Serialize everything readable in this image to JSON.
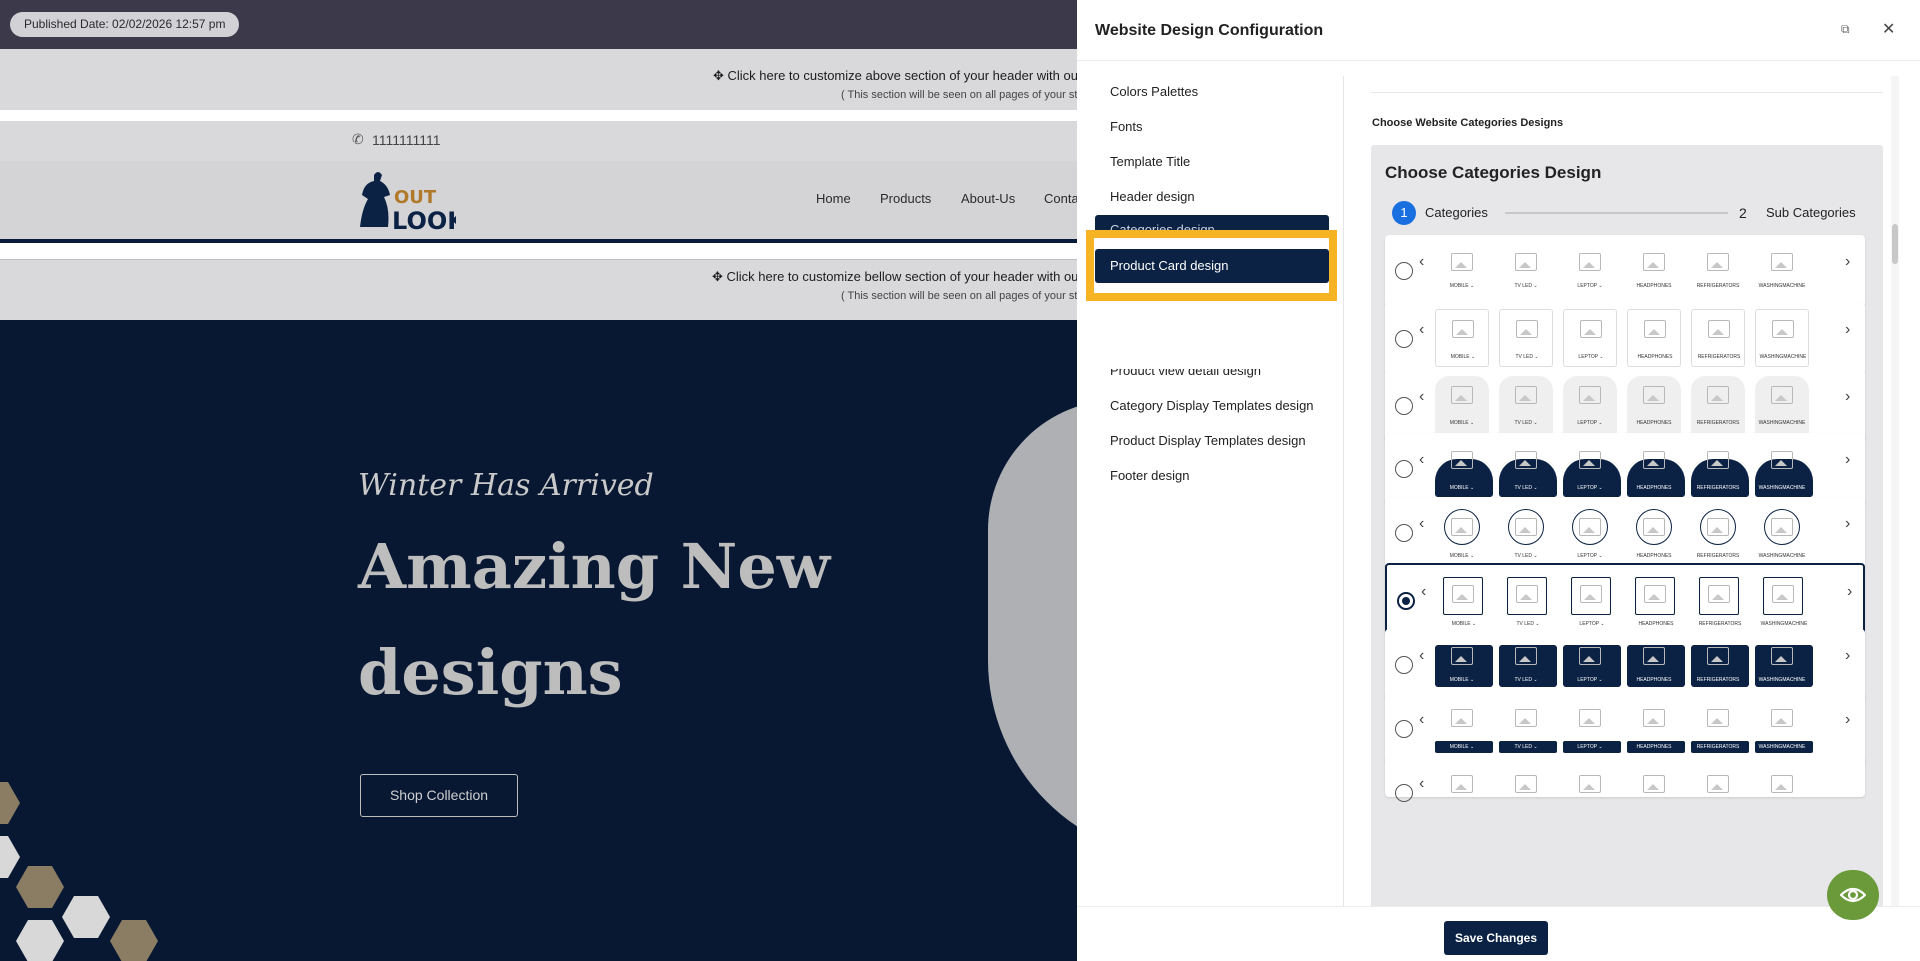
{
  "preview": {
    "published": "Published Date: 02/02/2026 12:57 pm",
    "header_top_line1": "✥ Click here to customize above section of your header with our po",
    "header_top_line2": "( This section will be seen on all pages of your store",
    "phone": "1111111111",
    "nav": [
      "Home",
      "Products",
      "About-Us",
      "Conta"
    ],
    "header_bottom_line1": "✥ Click here to customize bellow section of your header with our po",
    "header_bottom_line2": "( This section will be seen on all pages of your store",
    "hero_subtitle": "Winter Has Arrived",
    "hero_title1": "Amazing New",
    "hero_title2": "designs",
    "hero_button": "Shop Collection",
    "logo_text1": "OUT",
    "logo_text2": "LOOK"
  },
  "panel": {
    "title": "Website Design Configuration",
    "menu": {
      "colors": "Colors Palettes",
      "fonts": "Fonts",
      "template_title": "Template Title",
      "header": "Header design",
      "categories": "Categories design",
      "product_card": "Product Card design",
      "product_view": "Product view detail design",
      "category_templates": "Category Display Templates design",
      "product_templates": "Product Display Templates design",
      "footer": "Footer design"
    },
    "section_label": "Choose Website Categories Designs",
    "box_title": "Choose Categories Design",
    "step1_num": "1",
    "step1_label": "Categories",
    "step2_num": "2",
    "step2_label": "Sub Categories",
    "categories": [
      "MOBILE ⌄",
      "TV LED ⌄",
      "LEPTOP ⌄",
      "HEADPHONES",
      "REFRIGERATORS",
      "WASHINGMACHINE"
    ],
    "selected_option": 6,
    "save": "Save Changes"
  },
  "colors": {
    "navy": "#0b2244",
    "highlight": "#f6b324",
    "step_blue": "#1a6fe0",
    "eye_button": "#6a9a3a"
  },
  "icons": [
    "phone-icon",
    "expand-icon",
    "close-icon",
    "chevron-left-icon",
    "chevron-right-icon",
    "image-placeholder-icon",
    "eye-icon"
  ]
}
